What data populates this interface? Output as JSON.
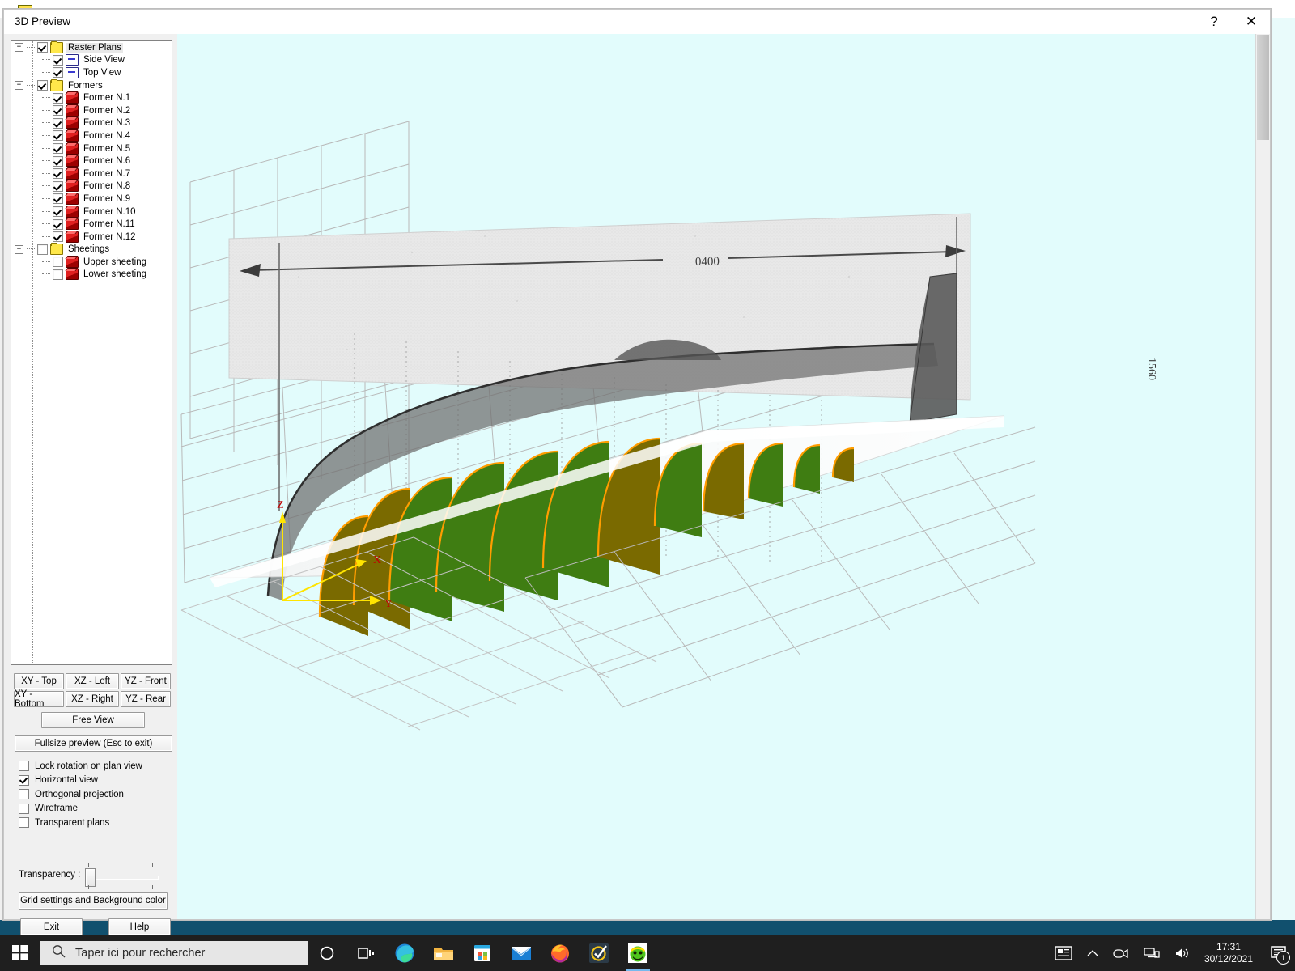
{
  "window": {
    "title": "3D Preview",
    "help_button": "?",
    "close_button": "✕"
  },
  "tree": {
    "nodes": [
      {
        "label": "Raster Plans",
        "icon": "folder-icon",
        "checked": true,
        "level": 0,
        "expander": "−",
        "selected": true
      },
      {
        "label": "Side View",
        "icon": "plan-icon",
        "checked": true,
        "level": 1,
        "expander": "",
        "selected": false
      },
      {
        "label": "Top View",
        "icon": "plan-icon",
        "checked": true,
        "level": 1,
        "expander": "",
        "selected": false
      },
      {
        "label": "Formers",
        "icon": "folder-icon",
        "checked": true,
        "level": 0,
        "expander": "−",
        "selected": false
      },
      {
        "label": "Former N.1",
        "icon": "cube-icon",
        "checked": true,
        "level": 1,
        "expander": "",
        "selected": false
      },
      {
        "label": "Former N.2",
        "icon": "cube-icon",
        "checked": true,
        "level": 1,
        "expander": "",
        "selected": false
      },
      {
        "label": "Former N.3",
        "icon": "cube-icon",
        "checked": true,
        "level": 1,
        "expander": "",
        "selected": false
      },
      {
        "label": "Former N.4",
        "icon": "cube-icon",
        "checked": true,
        "level": 1,
        "expander": "",
        "selected": false
      },
      {
        "label": "Former N.5",
        "icon": "cube-icon",
        "checked": true,
        "level": 1,
        "expander": "",
        "selected": false
      },
      {
        "label": "Former N.6",
        "icon": "cube-icon",
        "checked": true,
        "level": 1,
        "expander": "",
        "selected": false
      },
      {
        "label": "Former N.7",
        "icon": "cube-icon",
        "checked": true,
        "level": 1,
        "expander": "",
        "selected": false
      },
      {
        "label": "Former N.8",
        "icon": "cube-icon",
        "checked": true,
        "level": 1,
        "expander": "",
        "selected": false
      },
      {
        "label": "Former N.9",
        "icon": "cube-icon",
        "checked": true,
        "level": 1,
        "expander": "",
        "selected": false
      },
      {
        "label": "Former N.10",
        "icon": "cube-icon",
        "checked": true,
        "level": 1,
        "expander": "",
        "selected": false
      },
      {
        "label": "Former N.11",
        "icon": "cube-icon",
        "checked": true,
        "level": 1,
        "expander": "",
        "selected": false
      },
      {
        "label": "Former N.12",
        "icon": "cube-icon",
        "checked": true,
        "level": 1,
        "expander": "",
        "selected": false
      },
      {
        "label": "Sheetings",
        "icon": "folder-icon",
        "checked": false,
        "level": 0,
        "expander": "−",
        "selected": false
      },
      {
        "label": "Upper sheeting",
        "icon": "cube-icon",
        "checked": false,
        "level": 1,
        "expander": "",
        "selected": false
      },
      {
        "label": "Lower sheeting",
        "icon": "cube-icon",
        "checked": false,
        "level": 1,
        "expander": "",
        "selected": false
      }
    ]
  },
  "view_buttons": {
    "xy_top": "XY - Top",
    "xz_left": "XZ - Left",
    "yz_front": "YZ - Front",
    "xy_bottom": "XY - Bottom",
    "xz_right": "XZ - Right",
    "yz_rear": "YZ - Rear",
    "free_view": "Free View",
    "fullsize_preview": "Fullsize preview (Esc to exit)"
  },
  "options": [
    {
      "label": "Lock rotation on plan view",
      "checked": false
    },
    {
      "label": "Horizontal view",
      "checked": true
    },
    {
      "label": "Orthogonal projection",
      "checked": false
    },
    {
      "label": "Wireframe",
      "checked": false
    },
    {
      "label": "Transparent plans",
      "checked": false
    }
  ],
  "transparency": {
    "label": "Transparency :",
    "value": 0,
    "min": 0,
    "max": 100
  },
  "bottom_buttons": {
    "grid_settings": "Grid settings and Background color",
    "exit": "Exit",
    "help": "Help"
  },
  "viewport": {
    "background_color": "#e2fcfc",
    "axis": {
      "x": "X",
      "y": "Y",
      "z": "Z",
      "axis_color": "#ffe400",
      "label_color": "#c00000"
    },
    "former_fill": "#3f7d12",
    "former_fill_shadow": "#7a6a00",
    "former_outline": "#ff9d00",
    "plan_dimension_top": "0400",
    "plan_dimension_right": "1560",
    "grid_color": "#b3b3b3"
  },
  "taskbar": {
    "search_placeholder": "Taper ici pour rechercher",
    "time": "17:31",
    "date": "30/12/2021",
    "notification_count": "1",
    "icons": [
      "cortana-icon",
      "task-view-icon",
      "edge-icon",
      "file-explorer-icon",
      "microsoft-store-icon",
      "mail-icon",
      "firefox-icon",
      "checkmark-app-icon",
      "plan-designer-app-icon"
    ],
    "tray_icons": [
      "news-icon",
      "show-hidden-icons-icon",
      "camera-icon",
      "network-icon",
      "volume-icon"
    ]
  }
}
